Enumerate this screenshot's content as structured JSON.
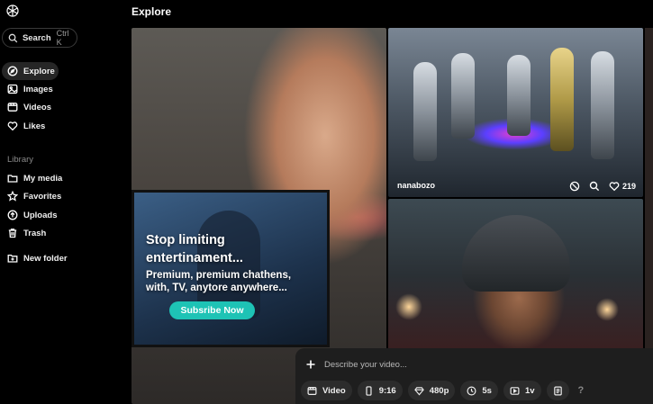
{
  "page": {
    "title": "Explore"
  },
  "search": {
    "label": "Search",
    "shortcut": "Ctrl K"
  },
  "nav": {
    "items": [
      {
        "label": "Explore",
        "icon": "compass-icon",
        "active": true
      },
      {
        "label": "Images",
        "icon": "image-icon"
      },
      {
        "label": "Videos",
        "icon": "video-icon"
      },
      {
        "label": "Likes",
        "icon": "heart-icon"
      }
    ],
    "library_label": "Library",
    "library": [
      {
        "label": "My media",
        "icon": "media-icon"
      },
      {
        "label": "Favorites",
        "icon": "star-icon"
      },
      {
        "label": "Uploads",
        "icon": "upload-icon"
      },
      {
        "label": "Trash",
        "icon": "trash-icon"
      }
    ],
    "new_folder": "New folder"
  },
  "ad": {
    "title": "Stop limiting entertinament...",
    "subtitle": "Premium, premium chathens, with, TV, anytore anywhere...",
    "button": "Subsribe Now",
    "button_color": "#1ec3b5"
  },
  "tiles": {
    "robots": {
      "author": "nanabozo",
      "likes": "219"
    }
  },
  "prompt": {
    "placeholder": "Describe your video...",
    "chips": {
      "type": "Video",
      "aspect": "9:16",
      "quality": "480p",
      "duration": "5s",
      "variations": "1v"
    },
    "help": "?"
  }
}
